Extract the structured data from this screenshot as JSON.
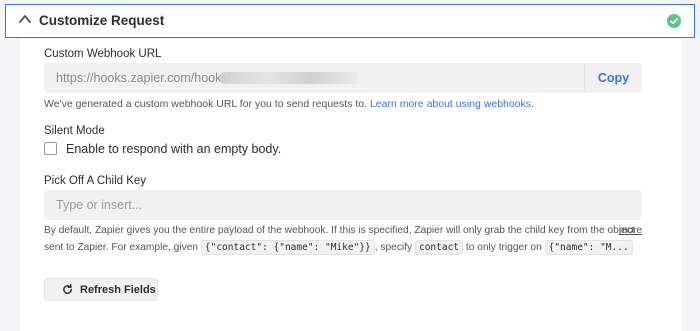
{
  "header": {
    "title": "Customize Request",
    "status_color": "#5fc48e",
    "accent_color": "#3d73e8"
  },
  "webhook_url": {
    "label": "Custom Webhook URL",
    "value": "https://hooks.zapier.com/hooks/",
    "copy_label": "Copy",
    "help_text": "We've generated a custom webhook URL for you to send requests to.",
    "help_link": "Learn more about using webhooks."
  },
  "silent_mode": {
    "label": "Silent Mode",
    "checkbox_label": "Enable to respond with an empty body.",
    "checked": false
  },
  "child_key": {
    "label": "Pick Off A Child Key",
    "placeholder": "Type or insert...",
    "desc_line1": "By default, Zapier gives you the entire payload of the webhook. If this is specified, Zapier will only grab the child key from the object",
    "desc_line2_a": "sent to Zapier. For example, given",
    "code1": "{\"contact\": {\"name\": \"Mike\"}}",
    "desc_line2_b": ", specify",
    "code2": "contact",
    "desc_line2_c": "to only trigger on",
    "code3": "{\"name\": \"M...",
    "more_label": "more"
  },
  "refresh": {
    "label": "Refresh Fields"
  },
  "icons": {
    "collapse": "chevron-up-icon",
    "status": "check-circle-icon",
    "refresh": "refresh-icon"
  }
}
